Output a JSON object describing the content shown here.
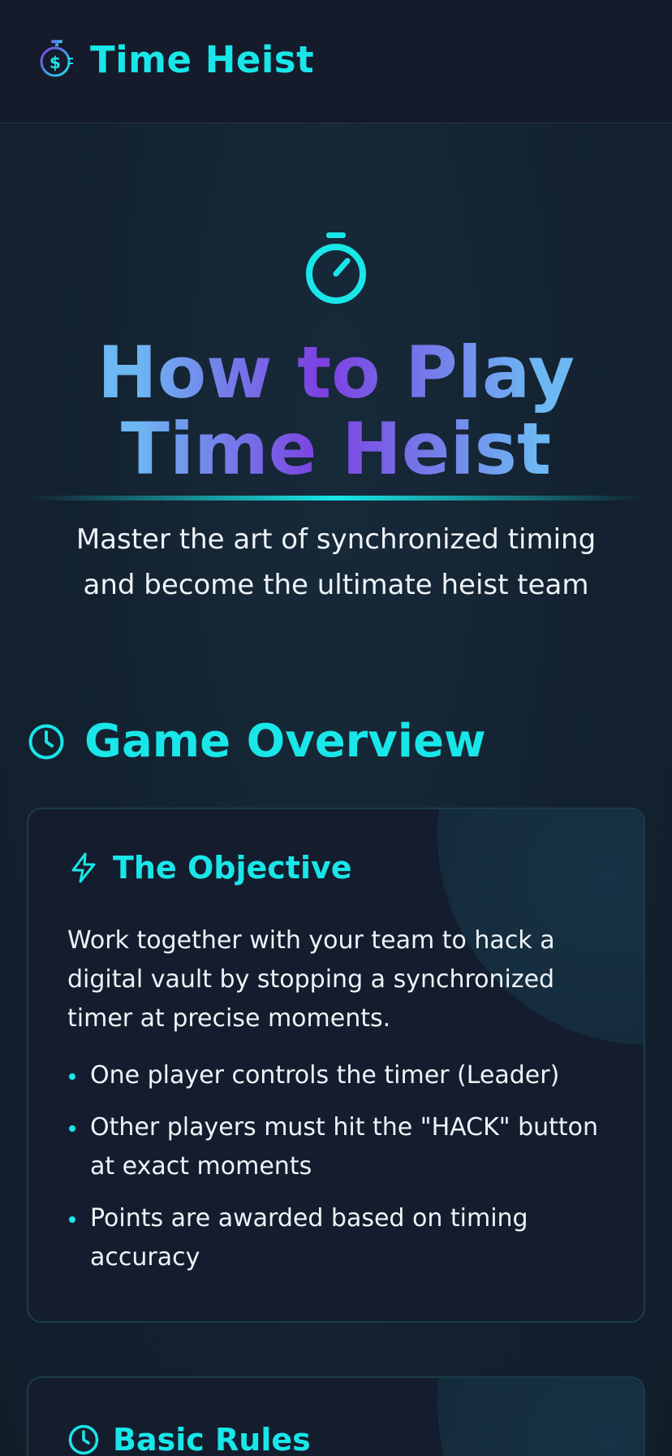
{
  "header": {
    "app_title": "Time Heist",
    "logo_icon": "stopwatch-dollar-icon"
  },
  "hero": {
    "icon": "stopwatch-icon",
    "title_line1": "How to Play",
    "title_line2": "Time Heist",
    "subtitle": "Master the art of synchronized timing and become the ultimate heist team"
  },
  "overview": {
    "icon": "clock-icon",
    "title": "Game Overview",
    "cards": [
      {
        "icon": "lightning-icon",
        "title": "The Objective",
        "text": "Work together with your team to hack a digital vault by stopping a synchronized timer at precise moments.",
        "bullets": [
          "One player controls the timer (Leader)",
          "Other players must hit the \"HACK\" button at exact moments",
          "Points are awarded based on timing accuracy"
        ]
      },
      {
        "icon": "clock-icon",
        "title": "Basic Rules"
      }
    ]
  },
  "colors": {
    "accent": "#19e6e8",
    "gradient_purple": "#7d3fe0",
    "gradient_blue": "#6db8f3",
    "background": "#13202e"
  }
}
